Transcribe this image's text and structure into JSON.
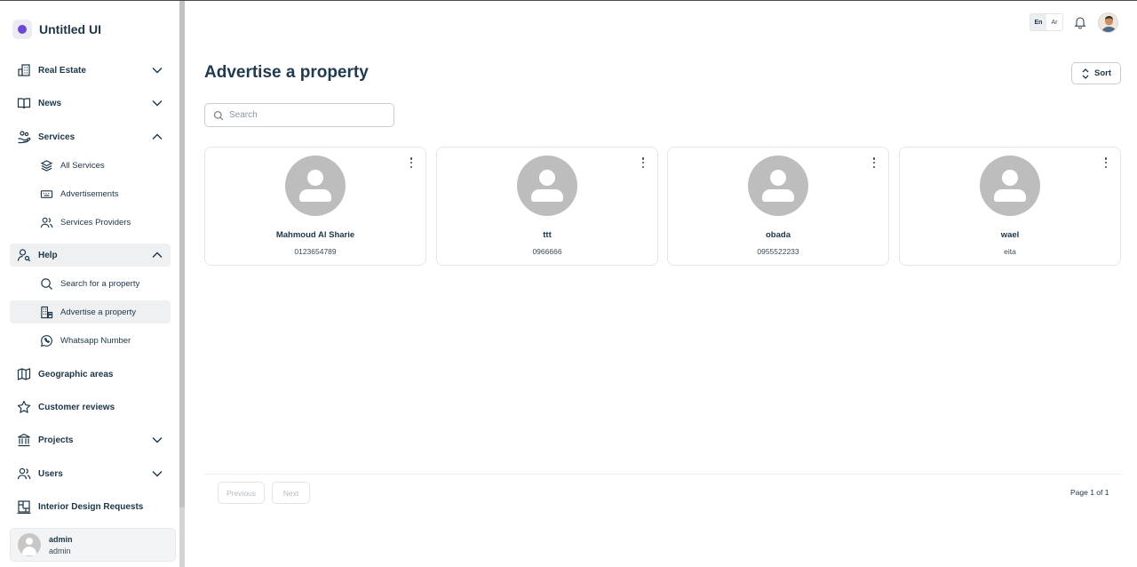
{
  "app": {
    "name": "Untitled UI"
  },
  "sidebar": {
    "items": [
      {
        "label": "Real Estate",
        "icon": "building-icon",
        "expandable": true,
        "expanded": false
      },
      {
        "label": "News",
        "icon": "book-open-icon",
        "expandable": true,
        "expanded": false
      },
      {
        "label": "Services",
        "icon": "hand-services-icon",
        "expandable": true,
        "expanded": true,
        "children": [
          {
            "label": "All Services",
            "icon": "layers-icon"
          },
          {
            "label": "Advertisements",
            "icon": "keyboard-icon"
          },
          {
            "label": "Services Providers",
            "icon": "users-icon"
          }
        ]
      },
      {
        "label": "Help",
        "icon": "user-search-icon",
        "expandable": true,
        "expanded": true,
        "active": true,
        "children": [
          {
            "label": "Search for a property",
            "icon": "search-icon"
          },
          {
            "label": "Advertise a property",
            "icon": "building-ad-icon",
            "active": true
          },
          {
            "label": "Whatsapp Number",
            "icon": "whatsapp-icon"
          }
        ]
      },
      {
        "label": "Geographic areas",
        "icon": "map-icon",
        "expandable": false
      },
      {
        "label": "Customer reviews",
        "icon": "star-icon",
        "expandable": false
      },
      {
        "label": "Projects",
        "icon": "bank-icon",
        "expandable": true,
        "expanded": false
      },
      {
        "label": "Users",
        "icon": "users-icon",
        "expandable": true,
        "expanded": false
      },
      {
        "label": "Interior Design Requests",
        "icon": "layout-icon",
        "expandable": false
      }
    ],
    "user": {
      "name": "admin",
      "role": "admin"
    }
  },
  "topbar": {
    "lang_en": "En",
    "lang_ar": "Ar",
    "active_lang": "En"
  },
  "main": {
    "title": "Advertise a property",
    "sort_label": "Sort",
    "search": {
      "placeholder": "Search",
      "value": ""
    },
    "cards": [
      {
        "name": "Mahmoud Al Sharie",
        "phone": "0123654789"
      },
      {
        "name": "ttt",
        "phone": "0966666"
      },
      {
        "name": "obada",
        "phone": "0955522233"
      },
      {
        "name": "wael",
        "phone": "eita"
      }
    ],
    "pagination": {
      "previous": "Previous",
      "next": "Next",
      "info": "Page 1 of 1"
    }
  },
  "colors": {
    "brand": "#6b48d6",
    "text": "#1f3a4d",
    "active_bg": "#eef0f2",
    "avatar_placeholder": "#bdbdbd"
  }
}
